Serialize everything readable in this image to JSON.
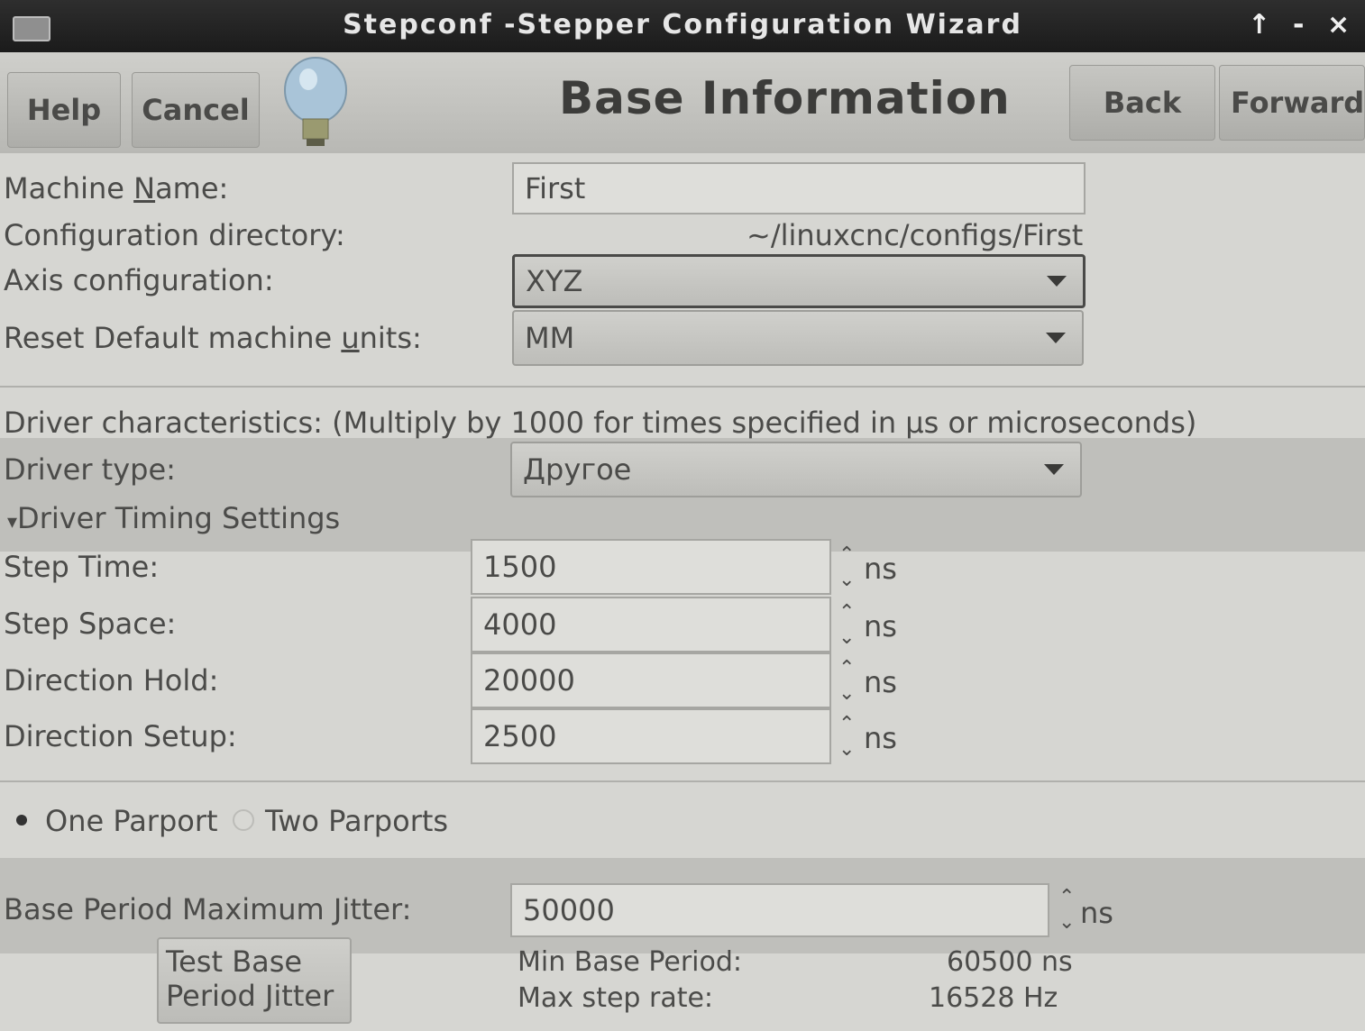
{
  "window": {
    "title": "Stepconf -Stepper Configuration Wizard",
    "controls": {
      "up": "↑",
      "minimize": "-",
      "close": "×"
    }
  },
  "toolbar": {
    "help": "Help",
    "cancel": "Cancel",
    "page_title": "Base Information",
    "back": "Back",
    "forward": "Forward"
  },
  "form": {
    "machine_name_label": "Machine Name:",
    "machine_name_value": "First",
    "config_dir_label": "Configuration directory:",
    "config_dir_value": "~/linuxcnc/configs/First",
    "axis_label": "Axis configuration:",
    "axis_value": "XYZ",
    "units_label": "Reset Default machine units:",
    "units_value": "MM"
  },
  "driver": {
    "heading": "Driver characteristics: (Multiply by 1000 for times specified in µs or microseconds)",
    "type_label": "Driver type:",
    "type_value": "Другое",
    "timing_expander": "Driver Timing Settings",
    "timings": [
      {
        "label": "Step Time:",
        "value": "1500",
        "unit": "ns"
      },
      {
        "label": "Step Space:",
        "value": "4000",
        "unit": "ns"
      },
      {
        "label": "Direction Hold:",
        "value": "20000",
        "unit": "ns"
      },
      {
        "label": "Direction Setup:",
        "value": "2500",
        "unit": "ns"
      }
    ]
  },
  "parport": {
    "one": "One Parport",
    "two": "Two Parports"
  },
  "jitter": {
    "label": "Base Period Maximum Jitter:",
    "value": "50000",
    "unit": "ns",
    "test_button_line1": "Test Base",
    "test_button_line2": "Period Jitter",
    "min_base_label": "Min Base Period:",
    "min_base_value": "60500 ns",
    "max_step_label": "Max step rate:",
    "max_step_value": "16528 Hz"
  }
}
